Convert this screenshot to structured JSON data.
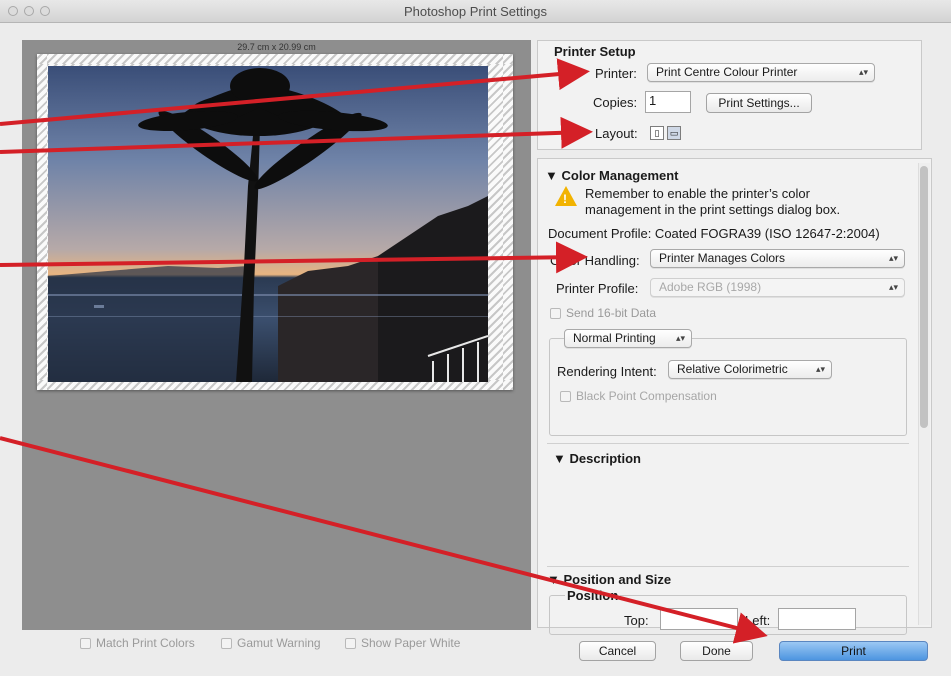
{
  "window": {
    "title": "Photoshop Print Settings"
  },
  "preview": {
    "dimensions": "29.7 cm x 20.99 cm",
    "options": {
      "match_print_colors": "Match Print Colors",
      "gamut_warning": "Gamut Warning",
      "show_paper_white": "Show Paper White"
    }
  },
  "printer_setup": {
    "heading": "Printer Setup",
    "printer_label": "Printer:",
    "printer_value": "Print Centre Colour Printer",
    "copies_label": "Copies:",
    "copies_value": "1",
    "print_settings_button": "Print Settings...",
    "layout_label": "Layout:"
  },
  "color_management": {
    "heading": "Color Management",
    "warning_line1": "Remember to enable the printer’s color",
    "warning_line2": "management in the print settings dialog box.",
    "document_profile": "Document Profile: Coated FOGRA39 (ISO 12647-2:2004)",
    "color_handling_label": "Color Handling:",
    "color_handling_value": "Printer Manages Colors",
    "printer_profile_label": "Printer Profile:",
    "printer_profile_value": "Adobe RGB (1998)",
    "send_16bit": "Send 16-bit Data",
    "printing_mode": "Normal Printing",
    "rendering_intent_label": "Rendering Intent:",
    "rendering_intent_value": "Relative Colorimetric",
    "black_point": "Black Point Compensation"
  },
  "description": {
    "heading": "Description"
  },
  "position_size": {
    "heading": "Position and Size",
    "position_label": "Position",
    "top_label": "Top:",
    "left_label": "Left:"
  },
  "footer": {
    "cancel": "Cancel",
    "done": "Done",
    "print": "Print"
  },
  "annotation_color": "#d42027",
  "icons": [
    "warning-icon",
    "disclosure-triangle-icon",
    "popup-arrows-icon",
    "portrait-layout-icon",
    "landscape-layout-icon"
  ]
}
